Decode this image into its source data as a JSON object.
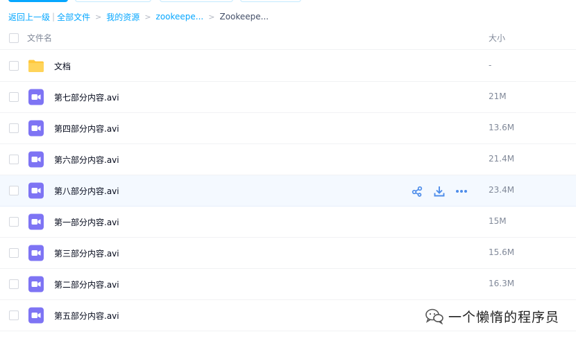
{
  "breadcrumb": {
    "back": "返回上一级",
    "separator": "|",
    "items": [
      "全部文件",
      "我的资源",
      "zookeepe..."
    ],
    "current": "Zookeepe..."
  },
  "table": {
    "columns": {
      "name": "文件名",
      "size": "大小"
    }
  },
  "files": [
    {
      "name": "文档",
      "size": "-",
      "type": "folder"
    },
    {
      "name": "第七部分内容.avi",
      "size": "21M",
      "type": "video"
    },
    {
      "name": "第四部分内容.avi",
      "size": "13.6M",
      "type": "video"
    },
    {
      "name": "第六部分内容.avi",
      "size": "21.4M",
      "type": "video"
    },
    {
      "name": "第八部分内容.avi",
      "size": "23.4M",
      "type": "video",
      "hovered": true
    },
    {
      "name": "第一部分内容.avi",
      "size": "15M",
      "type": "video"
    },
    {
      "name": "第三部分内容.avi",
      "size": "15.6M",
      "type": "video"
    },
    {
      "name": "第二部分内容.avi",
      "size": "16.3M",
      "type": "video"
    },
    {
      "name": "第五部分内容.avi",
      "size": "",
      "type": "video"
    }
  ],
  "row_actions": [
    "share-icon",
    "download-icon",
    "more-icon"
  ],
  "colors": {
    "accent": "#06a7ff",
    "folder": "#ffd45a",
    "video": "#7e74f4",
    "action": "#4e8dea"
  },
  "watermark": {
    "text": "一个懒惰的程序员",
    "icon": "wechat-icon"
  }
}
